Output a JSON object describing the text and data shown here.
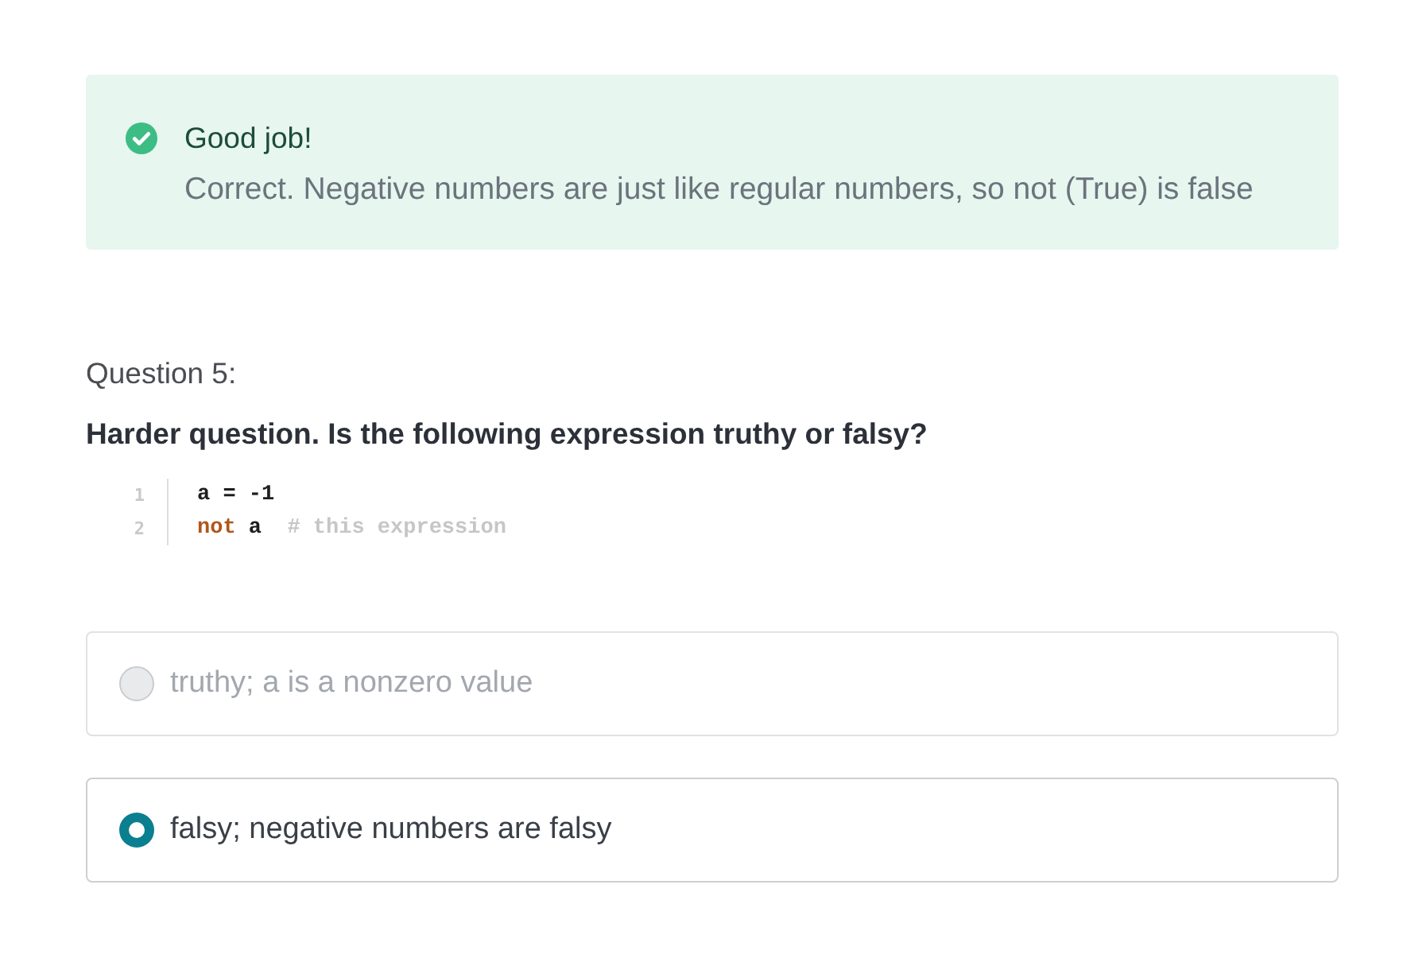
{
  "feedback": {
    "title": "Good job!",
    "message": "Correct. Negative numbers are just like regular numbers, so not (True) is false"
  },
  "question": {
    "label": "Question 5:",
    "prompt": "Harder question. Is the following expression truthy or falsy?",
    "code": [
      {
        "number": "1",
        "tokens": [
          {
            "kind": "plain",
            "text": "a = -1"
          }
        ]
      },
      {
        "number": "2",
        "tokens": [
          {
            "kind": "keyword",
            "text": "not "
          },
          {
            "kind": "plain",
            "text": "a  "
          },
          {
            "kind": "comment",
            "text": "# this expression"
          }
        ]
      }
    ]
  },
  "options": [
    {
      "text": "truthy; a is a nonzero value",
      "selected": false,
      "disabled": true
    },
    {
      "text": "falsy; negative numbers are falsy",
      "selected": true,
      "disabled": false
    }
  ]
}
